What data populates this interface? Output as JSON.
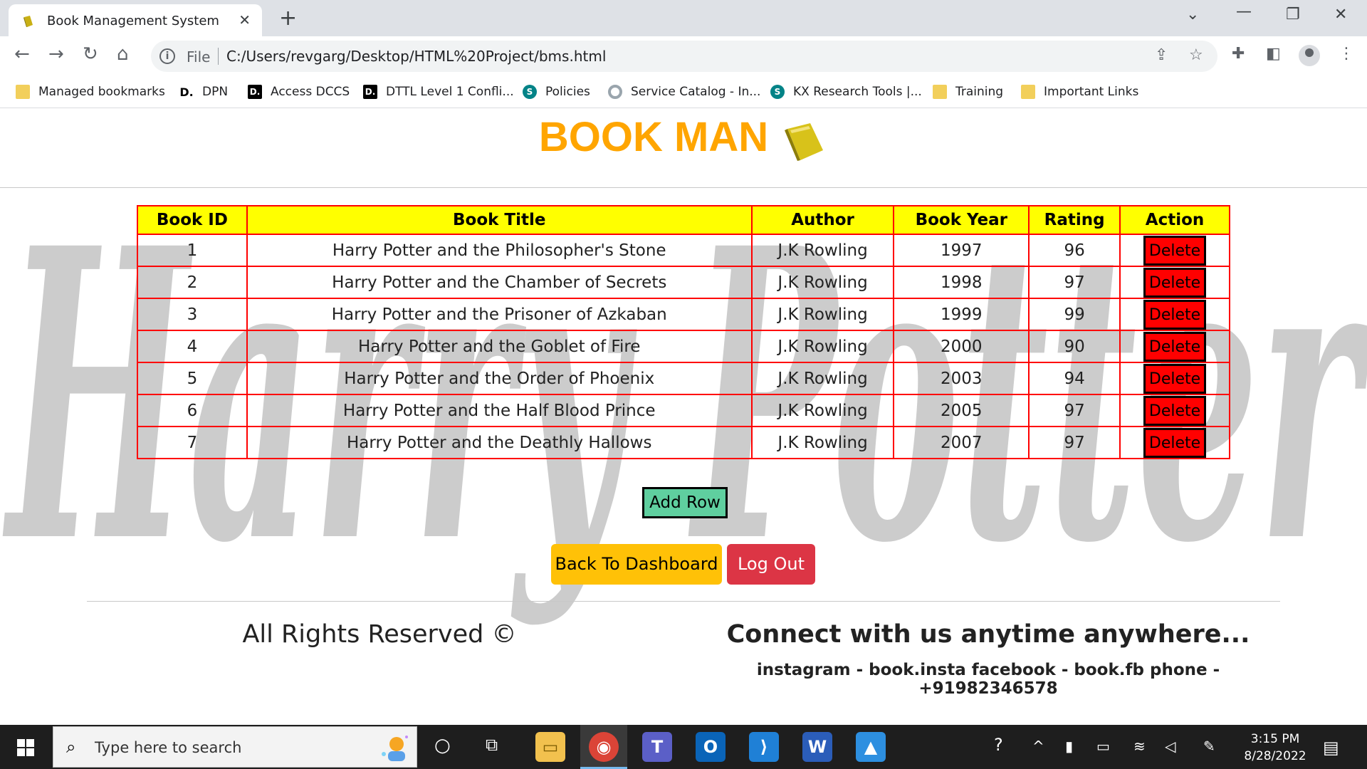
{
  "browser": {
    "tab_title": "Book Management System",
    "file_label": "File",
    "url": "C:/Users/revgarg/Desktop/HTML%20Project/bms.html",
    "bookmarks": [
      {
        "label": "Managed bookmarks",
        "icon": "folder-icon"
      },
      {
        "label": "DPN",
        "icon": "deloitte-icon"
      },
      {
        "label": "Access DCCS",
        "icon": "deloitte-icon"
      },
      {
        "label": "DTTL Level 1 Confli...",
        "icon": "deloitte-icon"
      },
      {
        "label": "Policies",
        "icon": "sharepoint-icon"
      },
      {
        "label": "Service Catalog - In...",
        "icon": "service-icon"
      },
      {
        "label": "KX Research Tools |...",
        "icon": "sharepoint-icon"
      },
      {
        "label": "Training",
        "icon": "folder-icon"
      },
      {
        "label": "Important Links",
        "icon": "folder-icon"
      }
    ]
  },
  "page": {
    "brand": "BOOK MAN",
    "watermark_text": "Harry Potter",
    "table": {
      "headers": [
        "Book ID",
        "Book Title",
        "Author",
        "Book Year",
        "Rating",
        "Action"
      ],
      "rows": [
        {
          "id": "1",
          "title": "Harry Potter and the Philosopher's Stone",
          "author": "J.K Rowling",
          "year": "1997",
          "rating": "96",
          "action": "Delete"
        },
        {
          "id": "2",
          "title": "Harry Potter and the Chamber of Secrets",
          "author": "J.K Rowling",
          "year": "1998",
          "rating": "97",
          "action": "Delete"
        },
        {
          "id": "3",
          "title": "Harry Potter and the Prisoner of Azkaban",
          "author": "J.K Rowling",
          "year": "1999",
          "rating": "99",
          "action": "Delete"
        },
        {
          "id": "4",
          "title": "Harry Potter and the Goblet of Fire",
          "author": "J.K Rowling",
          "year": "2000",
          "rating": "90",
          "action": "Delete"
        },
        {
          "id": "5",
          "title": "Harry Potter and the Order of Phoenix",
          "author": "J.K Rowling",
          "year": "2003",
          "rating": "94",
          "action": "Delete"
        },
        {
          "id": "6",
          "title": "Harry Potter and the Half Blood Prince",
          "author": "J.K Rowling",
          "year": "2005",
          "rating": "97",
          "action": "Delete"
        },
        {
          "id": "7",
          "title": "Harry Potter and the Deathly Hallows",
          "author": "J.K Rowling",
          "year": "2007",
          "rating": "97",
          "action": "Delete"
        }
      ]
    },
    "add_row_label": "Add Row",
    "back_label": "Back To Dashboard",
    "logout_label": "Log Out",
    "footer_left": "All Rights Reserved ©",
    "footer_right_title": "Connect with us anytime anywhere...",
    "footer_contacts": "instagram - book.insta facebook - book.fb phone - +91982346578"
  },
  "taskbar": {
    "search_placeholder": "Type here to search",
    "time": "3:15 PM",
    "date": "8/28/2022"
  },
  "colors": {
    "brand": "#ffa500",
    "table_header": "#ffff00",
    "table_border": "#ff0000",
    "delete_button": "#ff0000",
    "add_row_button": "#5fcf9f",
    "back_button": "#ffc107",
    "logout_button": "#dc3545"
  }
}
